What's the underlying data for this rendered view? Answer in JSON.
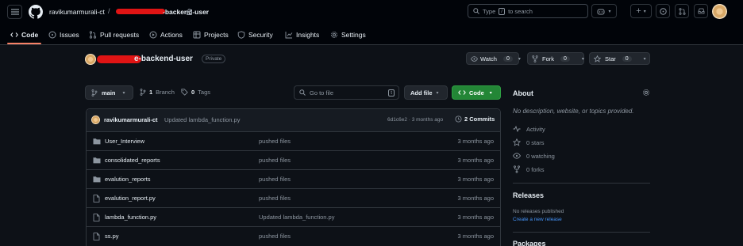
{
  "header": {
    "owner": "ravikumarmurali-ct",
    "separator": "/",
    "repo_suffix": "-backend-user",
    "search_placeholder_pre": "Type",
    "search_key": "/",
    "search_placeholder_post": "to search"
  },
  "tabs": [
    {
      "label": "Code",
      "icon": "code-icon"
    },
    {
      "label": "Issues",
      "icon": "issue-icon"
    },
    {
      "label": "Pull requests",
      "icon": "pull-request-icon"
    },
    {
      "label": "Actions",
      "icon": "play-icon"
    },
    {
      "label": "Projects",
      "icon": "table-icon"
    },
    {
      "label": "Security",
      "icon": "shield-icon"
    },
    {
      "label": "Insights",
      "icon": "graph-icon"
    },
    {
      "label": "Settings",
      "icon": "gear-icon"
    }
  ],
  "repo": {
    "title_suffix": "e-backend-user",
    "visibility": "Private",
    "watch": {
      "label": "Watch",
      "count": "0"
    },
    "fork": {
      "label": "Fork",
      "count": "0"
    },
    "star": {
      "label": "Star",
      "count": "0"
    }
  },
  "toolbar": {
    "branch": "main",
    "branches_count": "1",
    "branches_label": "Branch",
    "tags_count": "0",
    "tags_label": "Tags",
    "goto_placeholder": "Go to file",
    "goto_key": "t",
    "add_file": "Add file",
    "code": "Code"
  },
  "commit": {
    "author": "ravikumarmurali-ct",
    "message": "Updated lambda_function.py",
    "meta": "6d1c6e2 · 3 months ago",
    "commits": "2 Commits"
  },
  "files": [
    {
      "name": "User_Interview",
      "type": "folder",
      "message": "pushed files",
      "date": "3 months ago"
    },
    {
      "name": "consolidated_reports",
      "type": "folder",
      "message": "pushed files",
      "date": "3 months ago"
    },
    {
      "name": "evalution_reports",
      "type": "folder",
      "message": "pushed files",
      "date": "3 months ago"
    },
    {
      "name": "evalution_report.py",
      "type": "file",
      "message": "pushed files",
      "date": "3 months ago"
    },
    {
      "name": "lambda_function.py",
      "type": "file",
      "message": "Updated lambda_function.py",
      "date": "3 months ago"
    },
    {
      "name": "ss.py",
      "type": "file",
      "message": "pushed files",
      "date": "3 months ago"
    }
  ],
  "about": {
    "heading": "About",
    "description": "No description, website, or topics provided.",
    "activity": "Activity",
    "stars": "0 stars",
    "watching": "0 watching",
    "forks": "0 forks"
  },
  "releases": {
    "heading": "Releases",
    "none": "No releases published",
    "create": "Create a new release"
  },
  "packages": {
    "heading": "Packages"
  },
  "colors": {
    "accent": "#f78166",
    "green": "#238636",
    "link": "#4493f8",
    "redaction": "#e01414"
  }
}
